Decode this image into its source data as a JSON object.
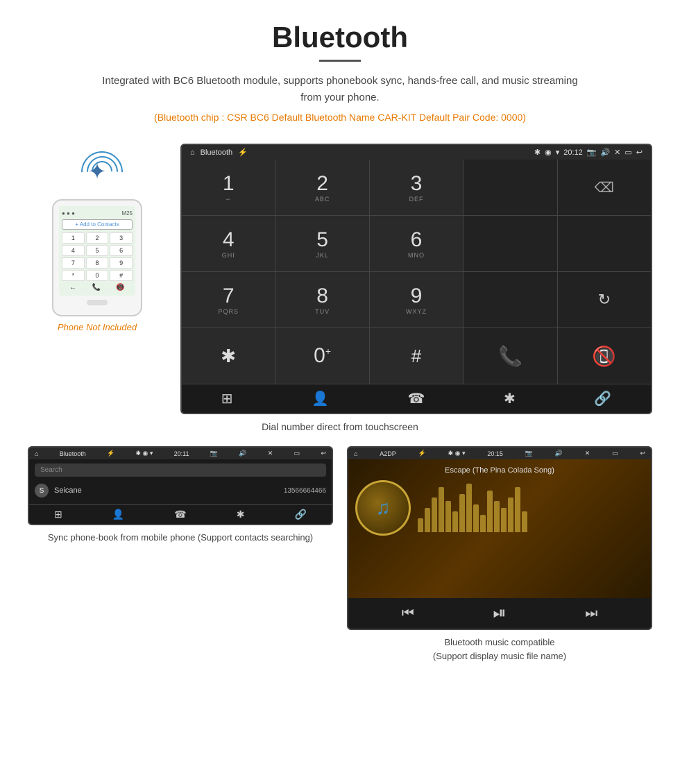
{
  "header": {
    "title": "Bluetooth",
    "description": "Integrated with BC6 Bluetooth module, supports phonebook sync, hands-free call, and music streaming from your phone.",
    "specs": "(Bluetooth chip : CSR BC6    Default Bluetooth Name CAR-KIT    Default Pair Code: 0000)"
  },
  "phone_mockup": {
    "not_included": "Phone Not Included",
    "add_contact": "+ Add to Contacts",
    "keys": [
      "1",
      "2",
      "3",
      "4",
      "5",
      "6",
      "7",
      "8",
      "9",
      "*",
      "0",
      "#"
    ]
  },
  "car_screen": {
    "status_bar": {
      "home_icon": "⌂",
      "title": "Bluetooth",
      "usb_icon": "⚡",
      "time": "20:12",
      "icons": [
        "📷",
        "🔊",
        "✕",
        "▭",
        "↩"
      ]
    },
    "dial_pad": [
      {
        "number": "1",
        "letters": "∽"
      },
      {
        "number": "2",
        "letters": "ABC"
      },
      {
        "number": "3",
        "letters": "DEF"
      },
      {
        "number": "",
        "letters": "",
        "special": "empty"
      },
      {
        "number": "",
        "letters": "",
        "special": "backspace"
      },
      {
        "number": "4",
        "letters": "GHI"
      },
      {
        "number": "5",
        "letters": "JKL"
      },
      {
        "number": "6",
        "letters": "MNO"
      },
      {
        "number": "",
        "letters": "",
        "special": "empty"
      },
      {
        "number": "",
        "letters": "",
        "special": "empty"
      },
      {
        "number": "7",
        "letters": "PQRS"
      },
      {
        "number": "8",
        "letters": "TUV"
      },
      {
        "number": "9",
        "letters": "WXYZ"
      },
      {
        "number": "",
        "letters": "",
        "special": "empty"
      },
      {
        "number": "",
        "letters": "",
        "special": "refresh"
      },
      {
        "number": "*",
        "letters": ""
      },
      {
        "number": "0",
        "letters": "+"
      },
      {
        "number": "#",
        "letters": ""
      },
      {
        "number": "",
        "letters": "",
        "special": "call-green"
      },
      {
        "number": "",
        "letters": "",
        "special": "call-red"
      }
    ],
    "bottom_nav": [
      "⊞",
      "👤",
      "☎",
      "✱",
      "🔗"
    ]
  },
  "dial_caption": "Dial number direct from touchscreen",
  "phonebook_screen": {
    "status_bar": {
      "home_icon": "⌂",
      "title": "Bluetooth",
      "usb_icon": "⚡",
      "time": "20:11"
    },
    "search_placeholder": "Search",
    "contacts": [
      {
        "initial": "S",
        "name": "Seicane",
        "phone": "13566664466"
      }
    ],
    "bottom_nav": [
      "⊞",
      "👤",
      "☎",
      "✱",
      "🔗"
    ]
  },
  "music_screen": {
    "status_bar": {
      "home_icon": "⌂",
      "title": "A2DP",
      "usb_icon": "⚡",
      "time": "20:15"
    },
    "song_title": "Escape (The Pina Colada Song)",
    "eq_bars": [
      20,
      35,
      50,
      65,
      45,
      30,
      55,
      70,
      40,
      25,
      60,
      45,
      35,
      50,
      65,
      30
    ],
    "controls": [
      "⏮",
      "⏯",
      "⏭"
    ]
  },
  "captions": {
    "phonebook": "Sync phone-book from mobile phone\n(Support contacts searching)",
    "music": "Bluetooth music compatible\n(Support display music file name)"
  }
}
